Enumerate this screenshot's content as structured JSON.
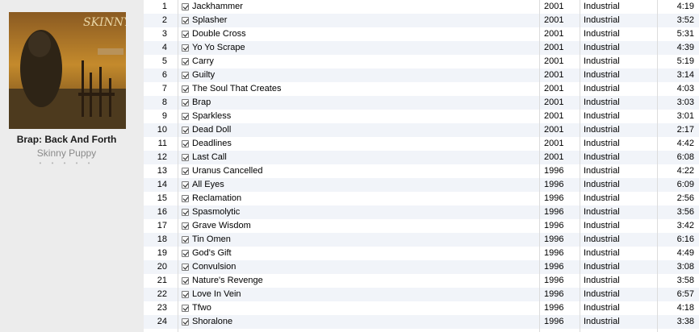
{
  "album": {
    "title": "Brap: Back And Forth",
    "artist": "Skinny Puppy",
    "art_text": "SKINNY PUPPY",
    "rating_dots": "• • • • •"
  },
  "tracks": [
    {
      "num": "1",
      "name": "Jackhammer",
      "year": "2001",
      "genre": "Industrial",
      "time": "4:19",
      "checked": true
    },
    {
      "num": "2",
      "name": "Splasher",
      "year": "2001",
      "genre": "Industrial",
      "time": "3:52",
      "checked": true
    },
    {
      "num": "3",
      "name": "Double Cross",
      "year": "2001",
      "genre": "Industrial",
      "time": "5:31",
      "checked": true
    },
    {
      "num": "4",
      "name": "Yo Yo Scrape",
      "year": "2001",
      "genre": "Industrial",
      "time": "4:39",
      "checked": true
    },
    {
      "num": "5",
      "name": "Carry",
      "year": "2001",
      "genre": "Industrial",
      "time": "5:19",
      "checked": true
    },
    {
      "num": "6",
      "name": "Guilty",
      "year": "2001",
      "genre": "Industrial",
      "time": "3:14",
      "checked": true
    },
    {
      "num": "7",
      "name": "The Soul That Creates",
      "year": "2001",
      "genre": "Industrial",
      "time": "4:03",
      "checked": true
    },
    {
      "num": "8",
      "name": "Brap",
      "year": "2001",
      "genre": "Industrial",
      "time": "3:03",
      "checked": true
    },
    {
      "num": "9",
      "name": "Sparkless",
      "year": "2001",
      "genre": "Industrial",
      "time": "3:01",
      "checked": true
    },
    {
      "num": "10",
      "name": "Dead Doll",
      "year": "2001",
      "genre": "Industrial",
      "time": "2:17",
      "checked": true
    },
    {
      "num": "11",
      "name": "Deadlines",
      "year": "2001",
      "genre": "Industrial",
      "time": "4:42",
      "checked": true
    },
    {
      "num": "12",
      "name": "Last Call",
      "year": "2001",
      "genre": "Industrial",
      "time": "6:08",
      "checked": true
    },
    {
      "num": "13",
      "name": "Uranus Cancelled",
      "year": "1996",
      "genre": "Industrial",
      "time": "4:22",
      "checked": true
    },
    {
      "num": "14",
      "name": "All Eyes",
      "year": "1996",
      "genre": "Industrial",
      "time": "6:09",
      "checked": true
    },
    {
      "num": "15",
      "name": "Reclamation",
      "year": "1996",
      "genre": "Industrial",
      "time": "2:56",
      "checked": true
    },
    {
      "num": "16",
      "name": "Spasmolytic",
      "year": "1996",
      "genre": "Industrial",
      "time": "3:56",
      "checked": true
    },
    {
      "num": "17",
      "name": "Grave Wisdom",
      "year": "1996",
      "genre": "Industrial",
      "time": "3:42",
      "checked": true
    },
    {
      "num": "18",
      "name": "Tin Omen",
      "year": "1996",
      "genre": "Industrial",
      "time": "6:16",
      "checked": true
    },
    {
      "num": "19",
      "name": "God's Gift",
      "year": "1996",
      "genre": "Industrial",
      "time": "4:49",
      "checked": true
    },
    {
      "num": "20",
      "name": "Convulsion",
      "year": "1996",
      "genre": "Industrial",
      "time": "3:08",
      "checked": true
    },
    {
      "num": "21",
      "name": "Nature's Revenge",
      "year": "1996",
      "genre": "Industrial",
      "time": "3:58",
      "checked": true
    },
    {
      "num": "22",
      "name": "Love In Vein",
      "year": "1996",
      "genre": "Industrial",
      "time": "6:57",
      "checked": true
    },
    {
      "num": "23",
      "name": "Tfwo",
      "year": "1996",
      "genre": "Industrial",
      "time": "4:18",
      "checked": true
    },
    {
      "num": "24",
      "name": "Shoralone",
      "year": "1996",
      "genre": "Industrial",
      "time": "3:38",
      "checked": true
    }
  ]
}
